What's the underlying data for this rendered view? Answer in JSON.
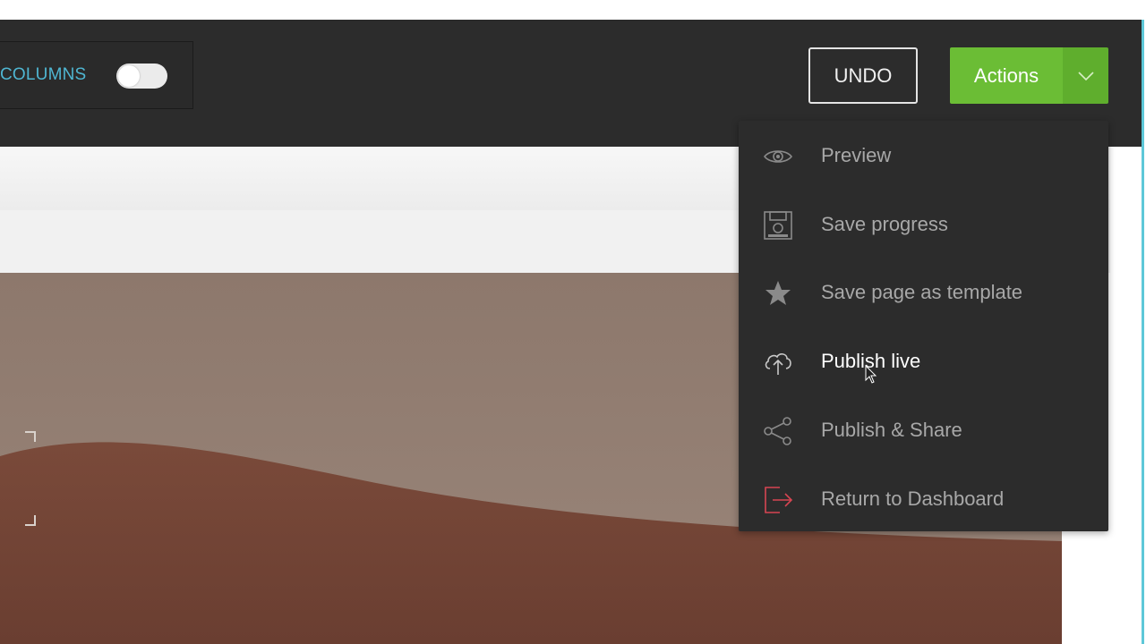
{
  "toolbar": {
    "columns_label": "COLUMNS",
    "columns_toggle_on": false,
    "undo_label": "UNDO",
    "actions_label": "Actions"
  },
  "actions_menu": {
    "items": [
      {
        "label": "Preview",
        "icon": "eye-icon"
      },
      {
        "label": "Save progress",
        "icon": "save-icon"
      },
      {
        "label": "Save page as template",
        "icon": "star-icon"
      },
      {
        "label": "Publish live",
        "icon": "cloud-upload-icon",
        "hovered": true
      },
      {
        "label": "Publish & Share",
        "icon": "share-icon"
      },
      {
        "label": "Return to Dashboard",
        "icon": "exit-icon"
      }
    ]
  },
  "colors": {
    "toolbar_bg": "#2c2c2c",
    "accent_green": "#6bbd35",
    "columns_blue": "#4fb6d2",
    "exit_icon_red": "#d64552"
  }
}
